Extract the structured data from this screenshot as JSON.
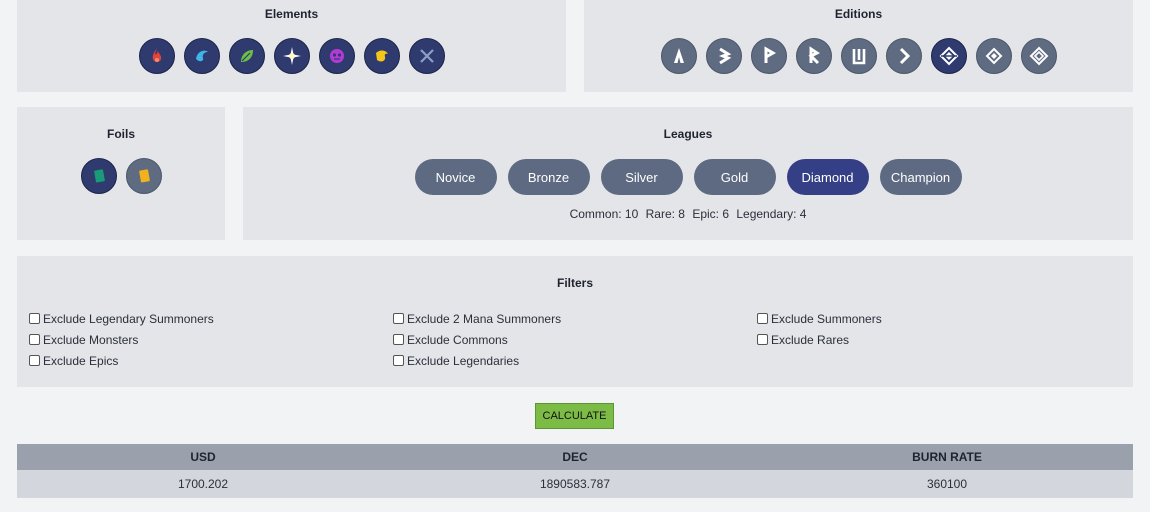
{
  "elements": {
    "title": "Elements",
    "icons": [
      "fire-icon",
      "water-icon",
      "earth-icon",
      "life-icon",
      "death-icon",
      "dragon-icon",
      "neutral-icon"
    ]
  },
  "editions": {
    "title": "Editions",
    "icons": [
      "alpha-rune-icon",
      "beta-rune-icon",
      "promo-rune-icon",
      "reward-rune-icon",
      "untamed-rune-icon",
      "dice-rune-icon",
      "chaos-legion-icon",
      "riftwatchers-icon",
      "rebellion-icon"
    ]
  },
  "foils": {
    "title": "Foils",
    "icons": [
      "regular-foil-icon",
      "gold-foil-icon"
    ]
  },
  "leagues": {
    "title": "Leagues",
    "buttons": [
      "Novice",
      "Bronze",
      "Silver",
      "Gold",
      "Diamond",
      "Champion"
    ],
    "active": "Diamond",
    "counts": {
      "common": "Common: 10",
      "rare": "Rare: 8",
      "epic": "Epic: 6",
      "legendary": "Legendary: 4"
    }
  },
  "filters": {
    "title": "Filters",
    "col1": [
      "Exclude Legendary Summoners",
      "Exclude Monsters",
      "Exclude Epics"
    ],
    "col2": [
      "Exclude 2 Mana Summoners",
      "Exclude Commons",
      "Exclude Legendaries"
    ],
    "col3": [
      "Exclude Summoners",
      "Exclude Rares"
    ]
  },
  "calculate_label": "CALCULATE",
  "results": {
    "headers": [
      "USD",
      "DEC",
      "BURN RATE"
    ],
    "values": [
      "1700.202",
      "1890583.787",
      "360100"
    ]
  },
  "colors": {
    "active_icon_bg": "#2f3a6e",
    "inactive_icon_bg": "#5f6b80",
    "league_active": "#353f86",
    "league_inactive": "#5d6a81",
    "calculate_bg": "#7dbb47"
  }
}
